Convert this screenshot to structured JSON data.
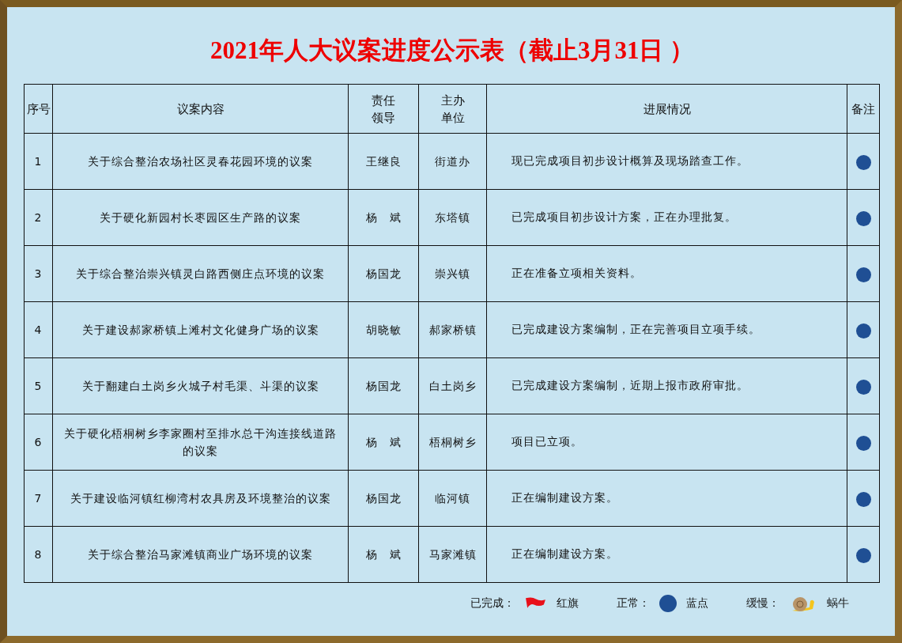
{
  "title": "2021年人大议案进度公示表（截止3月31日 ）",
  "table": {
    "columns": [
      "序号",
      "议案内容",
      "责任领导",
      "主办单位",
      "进展情况",
      "备注"
    ],
    "rows": [
      {
        "no": "1",
        "content": "关于综合整治农场社区灵春花园环境的议案",
        "leader": "王继良",
        "unit": "街道办",
        "progress": "现已完成项目初步设计概算及现场踏查工作。",
        "kind": "dot"
      },
      {
        "no": "2",
        "content": "关于硬化新园村长枣园区生产路的议案",
        "leader": "杨　斌",
        "unit": "东塔镇",
        "progress": "已完成项目初步设计方案，正在办理批复。",
        "kind": "dot"
      },
      {
        "no": "3",
        "content": "关于综合整治崇兴镇灵白路西侧庄点环境的议案",
        "leader": "杨国龙",
        "unit": "崇兴镇",
        "progress": "正在准备立项相关资料。",
        "kind": "dot"
      },
      {
        "no": "4",
        "content": "关于建设郝家桥镇上滩村文化健身广场的议案",
        "leader": "胡晓敏",
        "unit": "郝家桥镇",
        "progress": "已完成建设方案编制，正在完善项目立项手续。",
        "kind": "dot"
      },
      {
        "no": "5",
        "content": "关于翻建白土岗乡火城子村毛渠、斗渠的议案",
        "leader": "杨国龙",
        "unit": "白土岗乡",
        "progress": "已完成建设方案编制，近期上报市政府审批。",
        "kind": "dot"
      },
      {
        "no": "6",
        "content": "关于硬化梧桐树乡李家圈村至排水总干沟连接线道路的议案",
        "leader": "杨　斌",
        "unit": "梧桐树乡",
        "progress": "项目已立项。",
        "kind": "dot"
      },
      {
        "no": "7",
        "content": "关于建设临河镇红柳湾村农具房及环境整治的议案",
        "leader": "杨国龙",
        "unit": "临河镇",
        "progress": "正在编制建设方案。",
        "kind": "dot"
      },
      {
        "no": "8",
        "content": "关于综合整治马家滩镇商业广场环境的议案",
        "leader": "杨　斌",
        "unit": "马家滩镇",
        "progress": "正在编制建设方案。",
        "kind": "dot"
      }
    ]
  },
  "legend": [
    {
      "label": "已完成：",
      "kind": "flag",
      "name": "红旗"
    },
    {
      "label": "正常：",
      "kind": "dot",
      "name": "蓝点"
    },
    {
      "label": "缓慢：",
      "kind": "snail",
      "name": "蜗牛"
    }
  ]
}
